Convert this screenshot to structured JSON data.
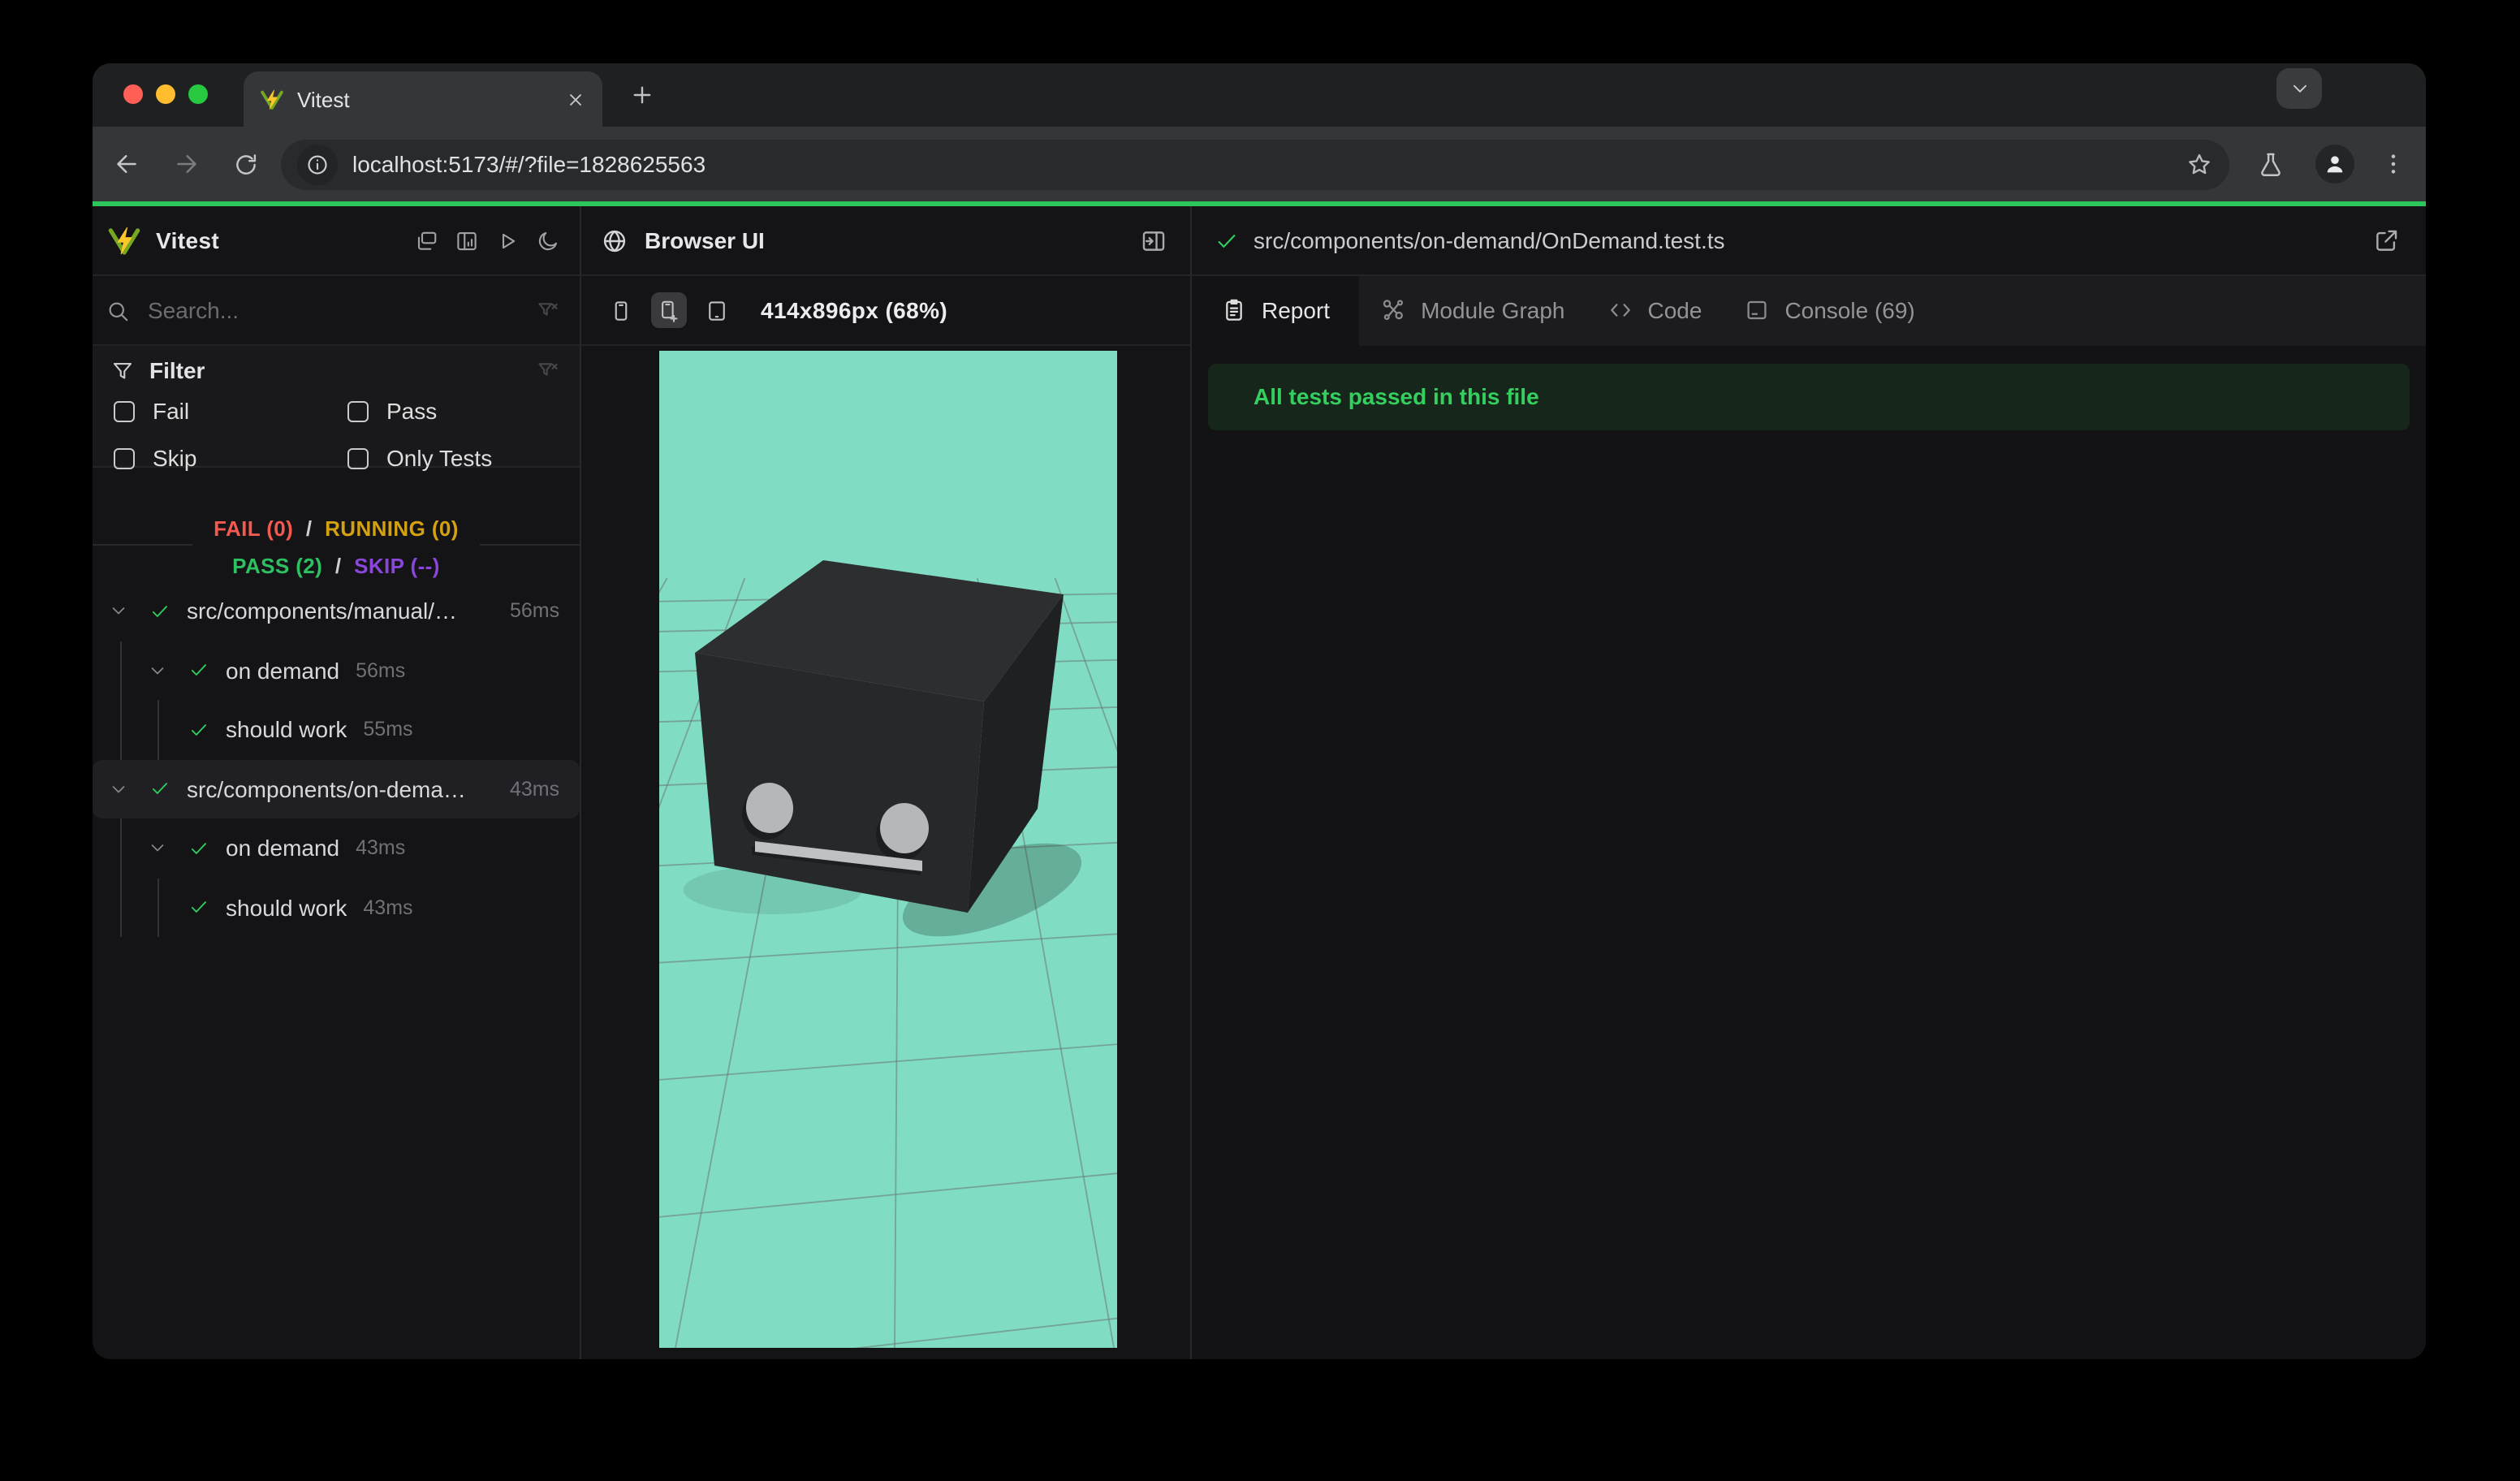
{
  "chrome": {
    "tab_title": "Vitest",
    "url": "localhost:5173/#/?file=1828625563",
    "traffic_lights": {
      "close": "#ff5f57",
      "minimize": "#febc2e",
      "zoom": "#28c840"
    }
  },
  "sidebar": {
    "title": "Vitest",
    "actions": [
      {
        "icon": "dashboard-icon"
      },
      {
        "icon": "layout-report-icon"
      },
      {
        "icon": "run-all-icon"
      },
      {
        "icon": "dark-mode-icon"
      }
    ],
    "search_placeholder": "Search...",
    "filter_heading": "Filter",
    "filters": [
      {
        "label": "Fail",
        "checked": false
      },
      {
        "label": "Pass",
        "checked": false
      },
      {
        "label": "Skip",
        "checked": false
      },
      {
        "label": "Only Tests",
        "checked": false
      }
    ],
    "stats_line1": [
      {
        "text": "FAIL (0)",
        "color": "#f4594f"
      },
      {
        "text": "/",
        "color": "#cfcfcf"
      },
      {
        "text": "RUNNING (0)",
        "color": "#d3a112"
      }
    ],
    "stats_line2": [
      {
        "text": "PASS (2)",
        "color": "#2dc161"
      },
      {
        "text": "/",
        "color": "#cfcfcf"
      },
      {
        "text": "SKIP (--)",
        "color": "#8a46d9"
      }
    ],
    "tree": [
      {
        "type": "file",
        "label": "src/components/manual/…",
        "duration": "56ms",
        "expanded": true,
        "selected": false
      },
      {
        "type": "suite",
        "label": "on demand",
        "duration": "56ms",
        "expanded": true,
        "selected": false
      },
      {
        "type": "test",
        "label": "should work",
        "duration": "55ms",
        "expanded": false,
        "selected": false
      },
      {
        "type": "file",
        "label": "src/components/on-dema…",
        "duration": "43ms",
        "expanded": true,
        "selected": true
      },
      {
        "type": "suite",
        "label": "on demand",
        "duration": "43ms",
        "expanded": true,
        "selected": false
      },
      {
        "type": "test",
        "label": "should work",
        "duration": "43ms",
        "expanded": false,
        "selected": false
      }
    ]
  },
  "browser_panel": {
    "title": "Browser UI",
    "viewport_label": "414x896px (68%)",
    "device_buttons": [
      {
        "icon": "device-phone-icon",
        "selected": false
      },
      {
        "icon": "device-phone-add-icon",
        "selected": true
      },
      {
        "icon": "device-tablet-icon",
        "selected": false
      }
    ]
  },
  "report_panel": {
    "file_path": "src/components/on-demand/OnDemand.test.ts",
    "tabs": [
      {
        "label": "Report",
        "icon": "report-icon",
        "active": true
      },
      {
        "label": "Module Graph",
        "icon": "module-graph-icon",
        "active": false
      },
      {
        "label": "Code",
        "icon": "code-icon",
        "active": false
      },
      {
        "label": "Console (69)",
        "icon": "console-icon",
        "active": false
      }
    ],
    "banner": "All tests passed in this file"
  },
  "colors": {
    "progress_green": "#2dc65a",
    "pass_check_green": "#2fce5f",
    "fail_red": "#f4594f",
    "running_yellow": "#d3a112",
    "skip_purple": "#8a46d9",
    "teal_background": "#80dcc3",
    "banner_background": "#17261b",
    "banner_text": "#35cf5f"
  }
}
